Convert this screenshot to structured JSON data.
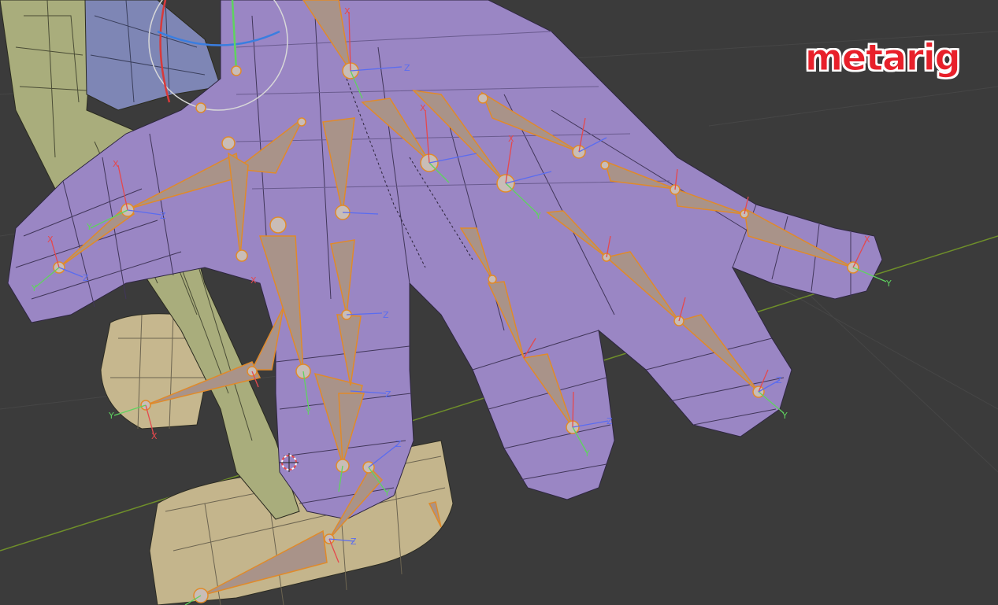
{
  "viewport": {
    "object_label": "metarig",
    "label_color": "#e8202a",
    "background_color": "#3b3b3b"
  },
  "colors": {
    "hand_mesh": "#9a86c4",
    "body_mesh": "#a9ad7c",
    "foot_mesh": "#c4b58c",
    "bone_fill": "#a99389",
    "bone_outline": "#e08a2a",
    "axis_x": "#e5484d",
    "axis_y": "#5fd35f",
    "axis_z": "#5a6cf0",
    "grid_x_axis": "#6f8f2a"
  },
  "icons": {
    "rotate_gizmo": "rotate-gizmo-icon",
    "cursor_3d": "3d-cursor-icon"
  },
  "axis_letters": {
    "x": "X",
    "y": "Y",
    "z": "Z"
  }
}
